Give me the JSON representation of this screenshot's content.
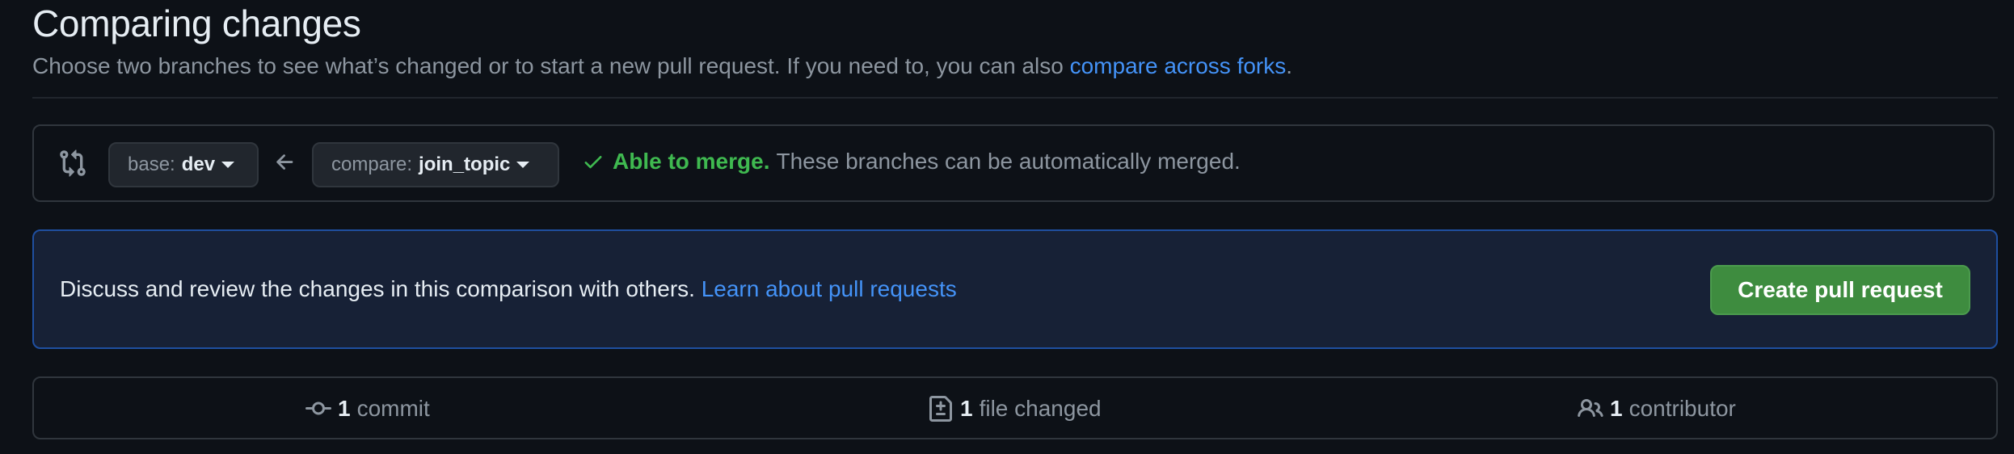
{
  "header": {
    "title": "Comparing changes",
    "subtitle_text": "Choose two branches to see what’s changed or to start a new pull request. If you need to, you can also ",
    "subtitle_link": "compare across forks",
    "subtitle_end": "."
  },
  "compare": {
    "base_label": "base:",
    "base_value": "dev",
    "compare_label": "compare:",
    "compare_value": "join_topic",
    "merge_status": "Able to merge.",
    "merge_description": "These branches can be automatically merged."
  },
  "banner": {
    "text": "Discuss and review the changes in this comparison with others. ",
    "link": "Learn about pull requests",
    "button": "Create pull request"
  },
  "stats": {
    "commits_count": "1",
    "commits_label": "commit",
    "files_count": "1",
    "files_label": "file changed",
    "contributors_count": "1",
    "contributors_label": "contributor"
  },
  "colors": {
    "background": "#0d1117",
    "link": "#4493f8",
    "success": "#3fb950",
    "primary_button": "#3e8c3f"
  },
  "icons": [
    "git-compare-icon",
    "chevron-down-icon",
    "arrow-left-icon",
    "check-icon",
    "git-commit-icon",
    "file-diff-icon",
    "people-icon"
  ]
}
